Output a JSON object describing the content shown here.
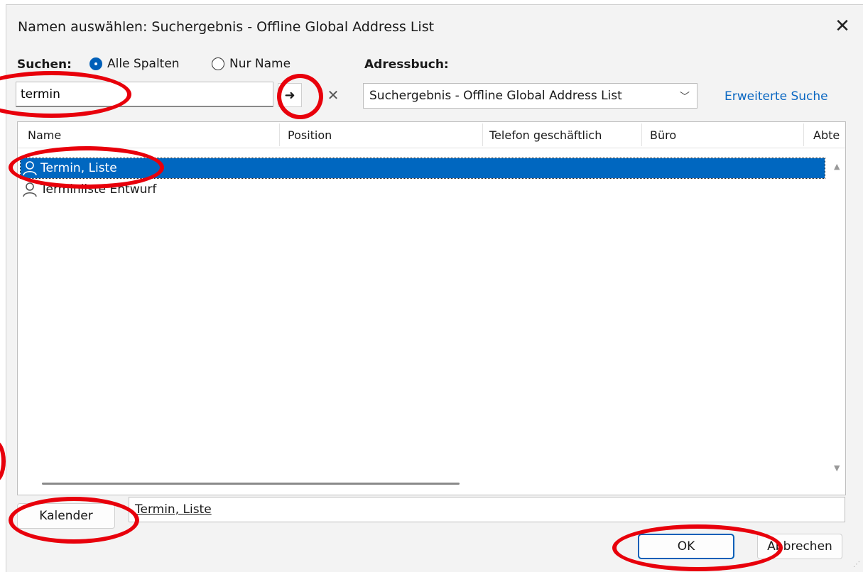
{
  "dialog": {
    "title": "Namen auswählen: Suchergebnis - Offline Global Address List",
    "close_glyph": "✕"
  },
  "search": {
    "label": "Suchen:",
    "option_all": "Alle Spalten",
    "option_name": "Nur Name",
    "selected_option": "Alle Spalten",
    "value": "termin",
    "go_glyph": "➜",
    "clear_glyph": "✕"
  },
  "addressbook": {
    "label": "Adressbuch:",
    "selected": "Suchergebnis - Offline Global Address List",
    "chevron": "﹀",
    "advanced_link": "Erweiterte Suche"
  },
  "list": {
    "columns": [
      "Name",
      "Position",
      "Telefon geschäftlich",
      "Büro",
      "Abte"
    ],
    "rows": [
      {
        "name": "Termin, Liste",
        "icon": "person-icon",
        "selected": true
      },
      {
        "name": "Terminliste Entwurf",
        "icon": "person-icon",
        "selected": false
      }
    ],
    "scroll_up": "▲",
    "scroll_down": "▼"
  },
  "footer": {
    "calendar_button": "Kalender",
    "calendar_value": "Termin, Liste",
    "ok_button": "OK",
    "cancel_button": "Abbrechen"
  },
  "colors": {
    "accent": "#005fb8",
    "selection": "#0067c0",
    "link": "#0a67c2",
    "annotation": "#e8000b"
  }
}
